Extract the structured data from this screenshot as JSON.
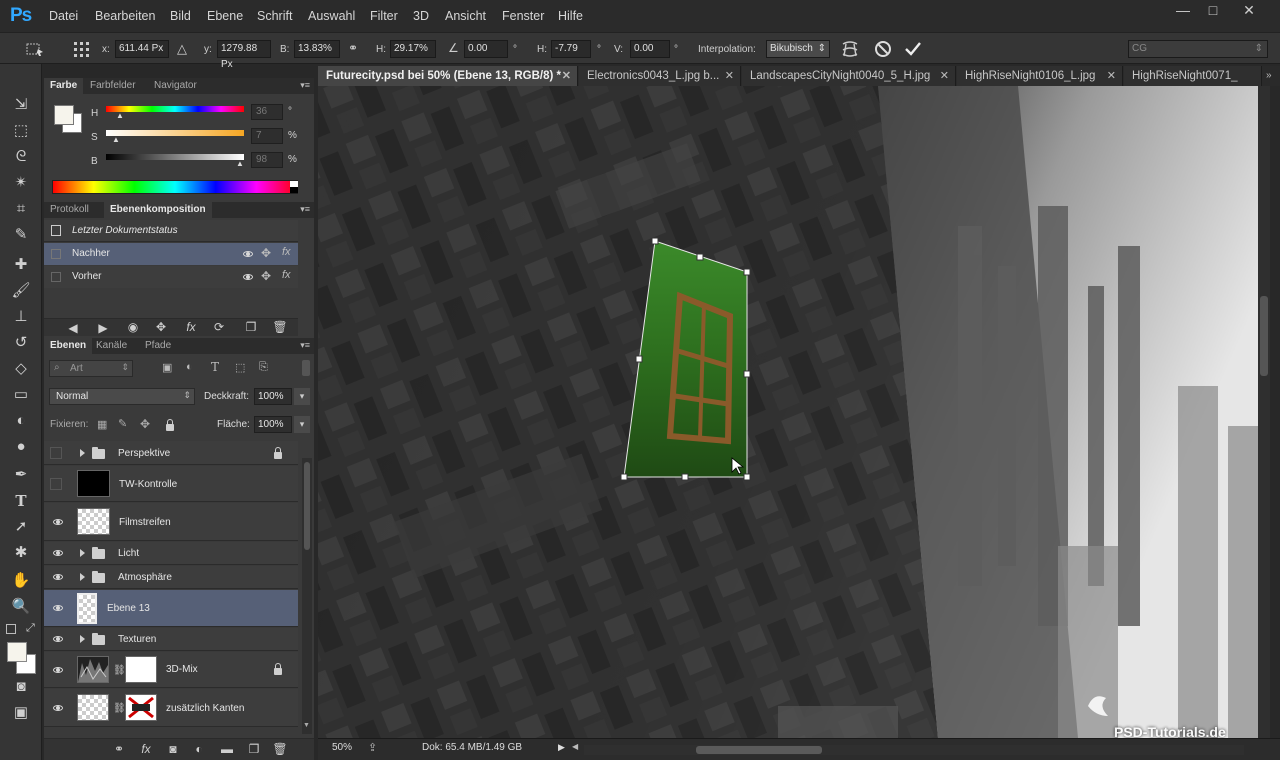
{
  "app": {
    "logo": "Ps"
  },
  "menu": [
    "Datei",
    "Bearbeiten",
    "Bild",
    "Ebene",
    "Schrift",
    "Auswahl",
    "Filter",
    "3D",
    "Ansicht",
    "Fenster",
    "Hilfe"
  ],
  "window_buttons": {
    "minimize": "—",
    "maximize": "□",
    "close": "✕"
  },
  "options": {
    "x_label": "x:",
    "x_value": "611.44 Px",
    "y_label": "y:",
    "y_value": "1279.88 Px",
    "b_label": "B:",
    "b_value": "13.83%",
    "h_label": "H:",
    "h_value": "29.17%",
    "angle_value": "0.00",
    "angle_unit": "°",
    "hskew_label": "H:",
    "hskew_value": "-7.79",
    "hskew_unit": "°",
    "vskew_label": "V:",
    "vskew_value": "0.00",
    "vskew_unit": "°",
    "interp_label": "Interpolation:",
    "interp_value": "Bikubisch",
    "workspace_value": "CG"
  },
  "color_panel": {
    "tabs": [
      "Farbe",
      "Farbfelder",
      "Navigator"
    ],
    "h_label": "H",
    "h_value": "36",
    "h_unit": "°",
    "s_label": "S",
    "s_value": "7",
    "s_unit": "%",
    "b_label": "B",
    "b_value": "98",
    "b_unit": "%",
    "foreground": "#f6f4ec",
    "background": "#ffffff"
  },
  "comp_panel": {
    "tabs": [
      "Protokoll",
      "Ebenenkomposition"
    ],
    "last_state": "Letzter Dokumentstatus",
    "items": [
      {
        "name": "Nachher",
        "selected": true
      },
      {
        "name": "Vorher",
        "selected": false
      }
    ]
  },
  "layers_panel": {
    "tabs": [
      "Ebenen",
      "Kanäle",
      "Pfade"
    ],
    "filter_label": "Art",
    "blend_mode": "Normal",
    "opacity_label": "Deckkraft:",
    "opacity_value": "100%",
    "lock_label": "Fixieren:",
    "fill_label": "Fläche:",
    "fill_value": "100%",
    "layers": [
      {
        "name": "Perspektive",
        "kind": "group",
        "visible": false,
        "locked": true
      },
      {
        "name": "TW-Kontrolle",
        "kind": "black",
        "visible": false
      },
      {
        "name": "Filmstreifen",
        "kind": "transparent",
        "visible": true
      },
      {
        "name": "Licht",
        "kind": "group",
        "visible": true
      },
      {
        "name": "Atmosphäre",
        "kind": "group",
        "visible": true
      },
      {
        "name": "Ebene 13",
        "kind": "transparent",
        "visible": true,
        "selected": true
      },
      {
        "name": "Texturen",
        "kind": "group",
        "visible": true
      },
      {
        "name": "3D-Mix",
        "kind": "masked",
        "visible": true,
        "locked": true
      },
      {
        "name": "zusätzlich Kanten",
        "kind": "masked-x",
        "visible": true
      }
    ]
  },
  "doc_tabs": [
    {
      "label": "Futurecity.psd bei 50% (Ebene 13, RGB/8) *",
      "active": true
    },
    {
      "label": "Electronics0043_L.jpg b...",
      "active": false
    },
    {
      "label": "LandscapesCityNight0040_5_H.jpg",
      "active": false
    },
    {
      "label": "HighRiseNight0106_L.jpg",
      "active": false
    },
    {
      "label": "HighRiseNight0071_",
      "active": false
    }
  ],
  "status": {
    "zoom": "50%",
    "doc": "Dok: 65.4 MB/1.49 GB"
  },
  "watermark": "PSD-Tutorials.de"
}
